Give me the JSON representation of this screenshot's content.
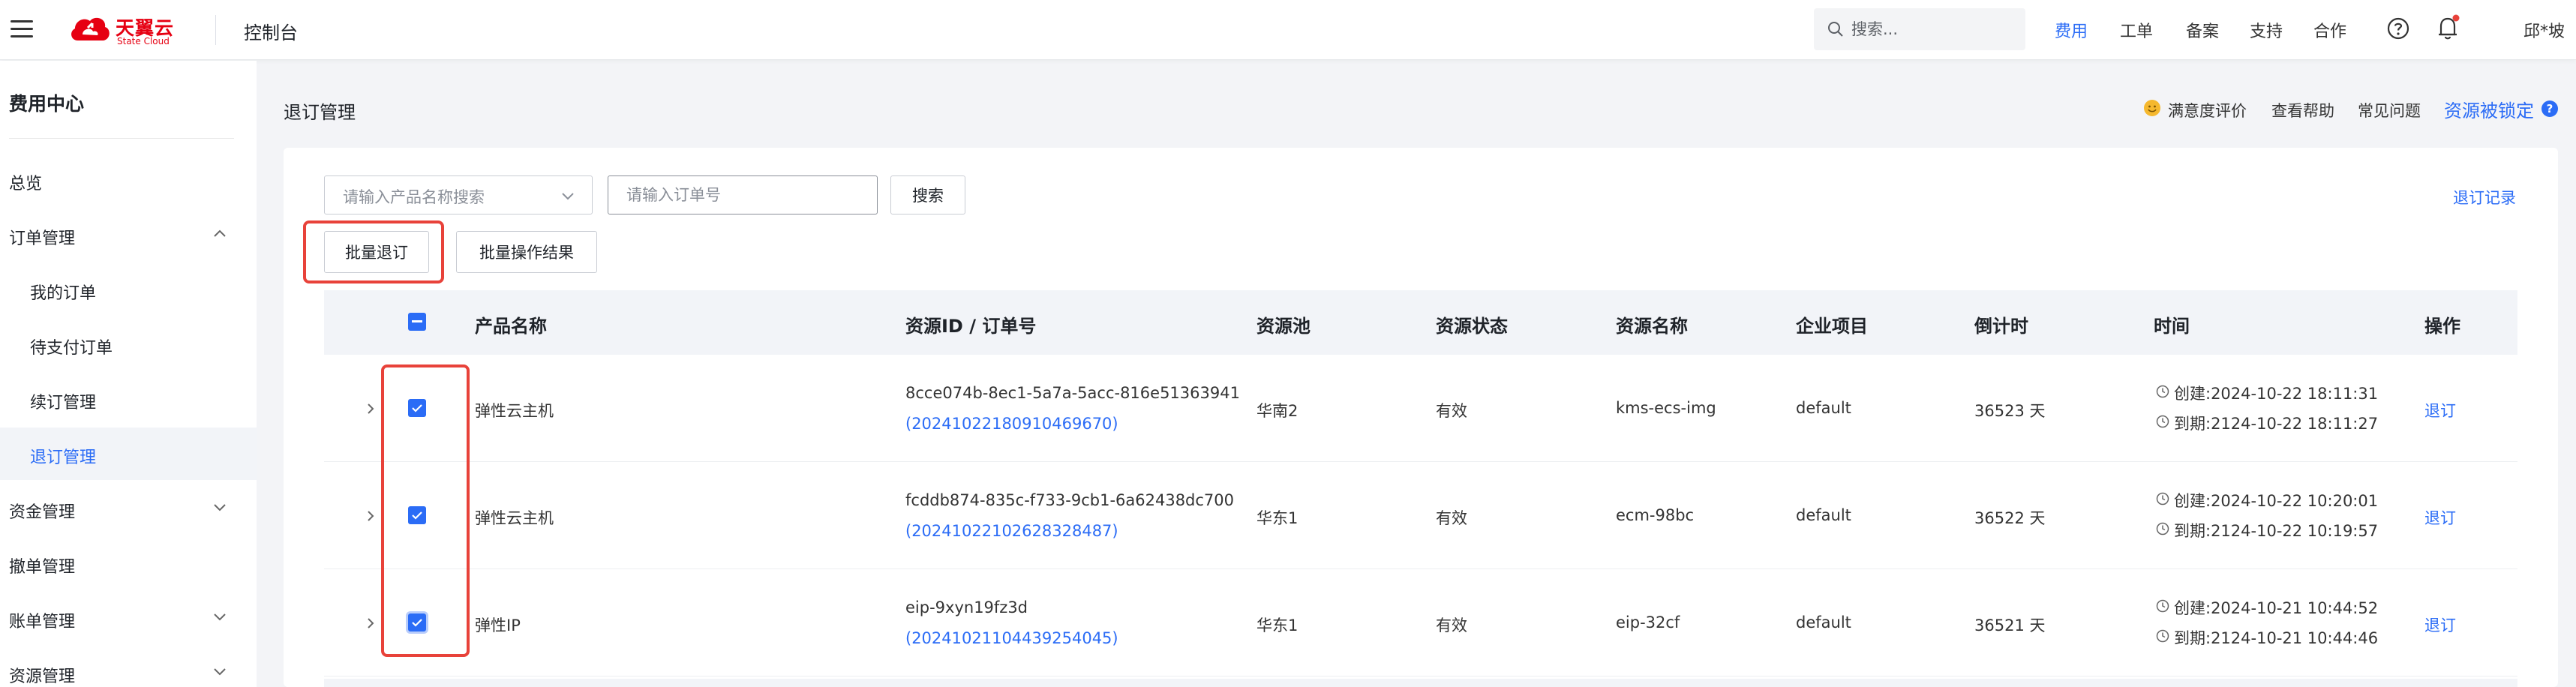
{
  "topbar": {
    "logo_text": "天翼云",
    "logo_sub": "State Cloud",
    "console_title": "控制台",
    "search_placeholder": "搜索...",
    "nav": [
      "费用",
      "工单",
      "备案",
      "支持",
      "合作"
    ],
    "active_nav": "费用",
    "user_name": "邱*坡",
    "icons": {
      "menu": "hamburger-icon",
      "search": "search-icon",
      "help": "help-circle-icon",
      "bell": "bell-icon"
    }
  },
  "sidebar": {
    "title": "费用中心",
    "items": [
      {
        "label": "总览",
        "level": "top",
        "chevron": ""
      },
      {
        "label": "订单管理",
        "level": "top",
        "chevron": "up"
      },
      {
        "label": "我的订单",
        "level": "sub",
        "chevron": ""
      },
      {
        "label": "待支付订单",
        "level": "sub",
        "chevron": ""
      },
      {
        "label": "续订管理",
        "level": "sub",
        "chevron": ""
      },
      {
        "label": "退订管理",
        "level": "sub",
        "chevron": "",
        "active": true
      },
      {
        "label": "资金管理",
        "level": "top",
        "chevron": "down"
      },
      {
        "label": "撤单管理",
        "level": "top",
        "chevron": ""
      },
      {
        "label": "账单管理",
        "level": "top",
        "chevron": "down"
      },
      {
        "label": "资源管理",
        "level": "top",
        "chevron": "down"
      }
    ]
  },
  "main": {
    "page_title": "退订管理",
    "header_links": {
      "satisfaction": "满意度评价",
      "help": "查看帮助",
      "faq": "常见问题",
      "locked": "资源被锁定",
      "locked_badge": "?"
    },
    "filters": {
      "product_placeholder": "请输入产品名称搜索",
      "order_placeholder": "请输入订单号",
      "search_button": "搜索",
      "batch_unsubscribe": "批量退订",
      "batch_result": "批量操作结果",
      "records_link": "退订记录"
    },
    "table": {
      "columns": [
        "产品名称",
        "资源ID / 订单号",
        "资源池",
        "资源状态",
        "资源名称",
        "企业项目",
        "倒计时",
        "时间",
        "操作"
      ],
      "rows": [
        {
          "product": "弹性云主机",
          "resource_id": "8cce074b-8ec1-5a7a-5acc-816e51363941",
          "order_no": "(20241022180910469670)",
          "pool": "华南2",
          "status": "有效",
          "name": "kms-ecs-img",
          "project": "default",
          "countdown": "36523 天",
          "created": "创建:2024-10-22 18:11:31",
          "expires": "到期:2124-10-22 18:11:27",
          "action": "退订"
        },
        {
          "product": "弹性云主机",
          "resource_id": "fcddb874-835c-f733-9cb1-6a62438dc700",
          "order_no": "(20241022102628328487)",
          "pool": "华东1",
          "status": "有效",
          "name": "ecm-98bc",
          "project": "default",
          "countdown": "36522 天",
          "created": "创建:2024-10-22 10:20:01",
          "expires": "到期:2124-10-22 10:19:57",
          "action": "退订"
        },
        {
          "product": "弹性IP",
          "resource_id": "eip-9xyn19fz3d",
          "order_no": "(20241021104439254045)",
          "pool": "华东1",
          "status": "有效",
          "name": "eip-32cf",
          "project": "default",
          "countdown": "36521 天",
          "created": "创建:2024-10-21 10:44:52",
          "expires": "到期:2124-10-21 10:44:46",
          "action": "退订"
        }
      ]
    }
  },
  "colors": {
    "accent": "#2b6cf6",
    "highlight": "#e8423a",
    "brand": "#e60012"
  }
}
